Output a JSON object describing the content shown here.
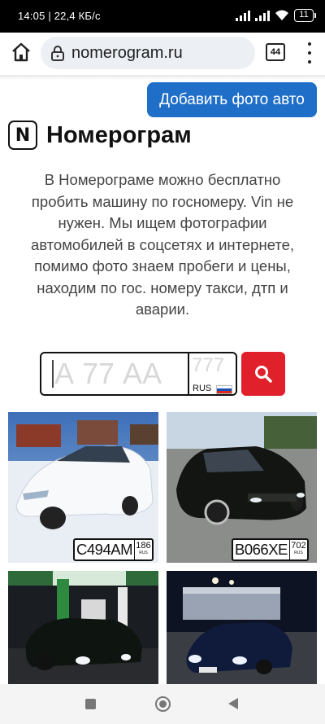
{
  "status_bar": {
    "time_speed": "14:05 | 22,4 КБ/с",
    "battery": "11"
  },
  "browser": {
    "url": "nomerogram.ru",
    "tab_count": "44"
  },
  "page": {
    "add_photo_button": "Добавить фото авто",
    "logo_letter": "N",
    "brand_name": "Номерограм",
    "intro_text": "В Номерограме можно бесплатно пробить машину по госномеру. Vin не нужен. Мы ищем фотографии автомобилей в соцсетях и интернете, помимо фото знаем пробеги и цены, находим по гос. номеру такси, дтп и аварии.",
    "plate_search": {
      "number_placeholder": "А 77 АА",
      "region_placeholder": "777",
      "country": "RUS",
      "flag_colors": [
        "#ffffff",
        "#1c4fb5",
        "#d52b1e"
      ]
    },
    "cars": [
      {
        "plate": "С494АМ",
        "region": "186",
        "country": "RUS"
      },
      {
        "plate": "В066ХЕ",
        "region": "702",
        "country": "RUS"
      },
      {
        "plate": "",
        "region": "",
        "country": ""
      },
      {
        "plate": "",
        "region": "",
        "country": ""
      }
    ],
    "accent_colors": {
      "primary_button": "#1f6fc9",
      "search_button": "#e0202a"
    }
  }
}
